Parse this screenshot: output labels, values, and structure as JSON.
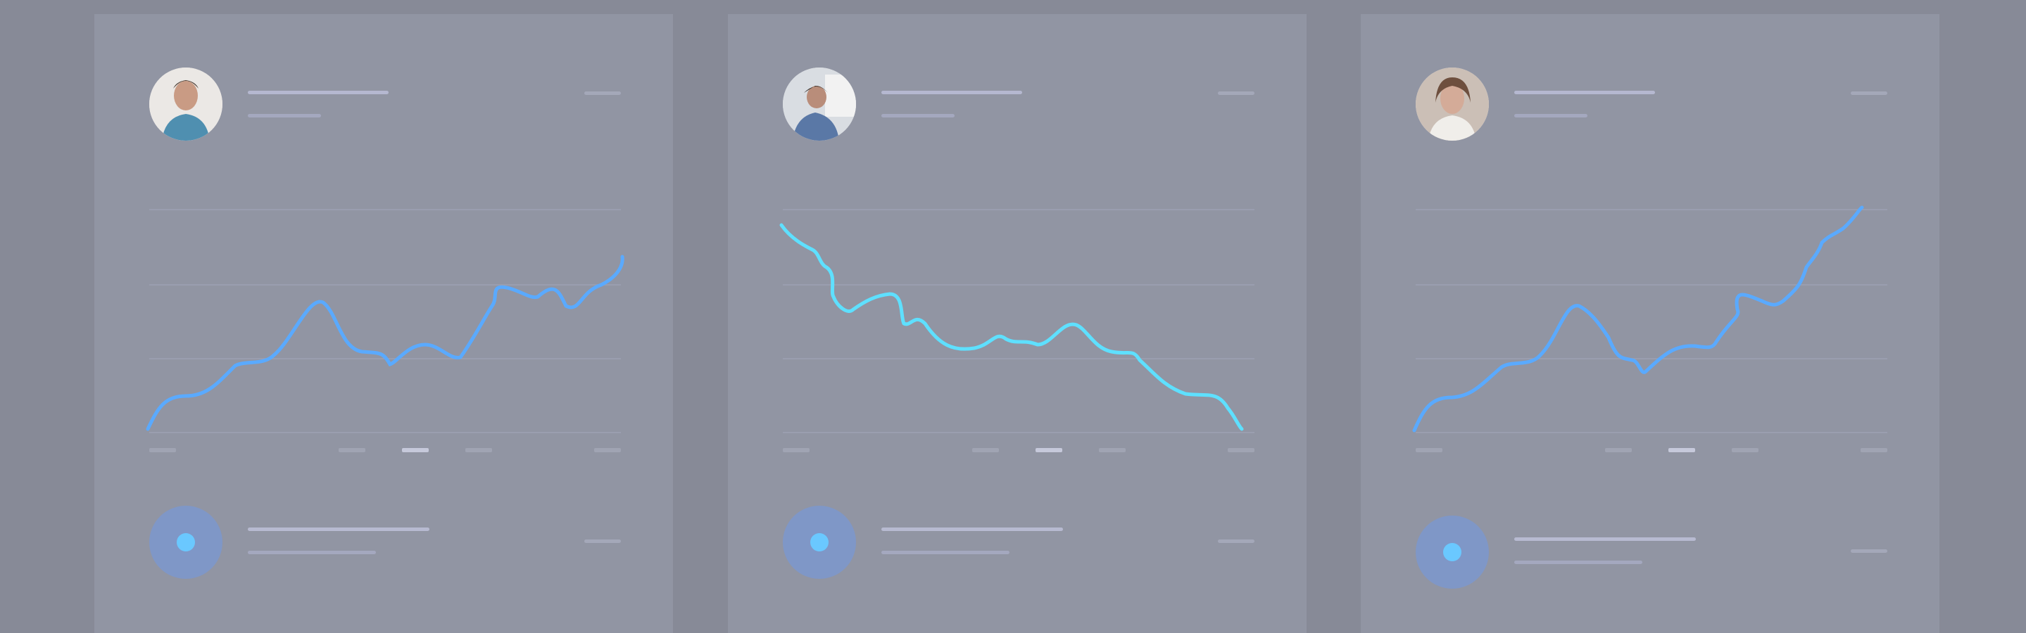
{
  "colors": {
    "background": "#878a97",
    "card": "#9195a3",
    "line_blue": "#5aaaff",
    "line_cyan": "#5ee0ff",
    "icon_bg": "#7f97c7",
    "icon_dot": "#6ac8ff"
  },
  "cards": [
    {
      "avatar_icon": "person-photo",
      "trend_line": "rising",
      "chart_data": {
        "type": "line",
        "series": [
          {
            "values": [
              0,
              14,
              15,
              22,
              29,
              30,
              42,
              55,
              66,
              40,
              32,
              30,
              38,
              42,
              35,
              50,
              60,
              57,
              70,
              66,
              74,
              64,
              72,
              80,
              92
            ]
          }
        ],
        "ylim": [
          0,
          100
        ],
        "grid": true
      },
      "x_ticks": 6,
      "active_tick": 3,
      "list_item_icon": "record-dot-icon"
    },
    {
      "avatar_icon": "person-photo",
      "trend_line": "falling",
      "chart_data": {
        "type": "line",
        "series": [
          {
            "values": [
              100,
              92,
              86,
              70,
              60,
              64,
              66,
              52,
              48,
              40,
              38,
              42,
              42,
              38,
              46,
              54,
              44,
              40,
              38,
              26,
              18,
              16,
              0
            ]
          }
        ],
        "ylim": [
          0,
          100
        ],
        "grid": true
      },
      "x_ticks": 6,
      "active_tick": 3,
      "list_item_icon": "record-dot-icon"
    },
    {
      "avatar_icon": "person-photo",
      "trend_line": "rising",
      "chart_data": {
        "type": "line",
        "series": [
          {
            "values": [
              0,
              14,
              17,
              24,
              31,
              32,
              46,
              56,
              66,
              40,
              32,
              30,
              38,
              42,
              40,
              52,
              62,
              58,
              70,
              62,
              74,
              82,
              92,
              100
            ]
          }
        ],
        "ylim": [
          0,
          100
        ],
        "grid": true
      },
      "x_ticks": 6,
      "active_tick": 3,
      "list_item_icon": "record-dot-icon"
    }
  ]
}
